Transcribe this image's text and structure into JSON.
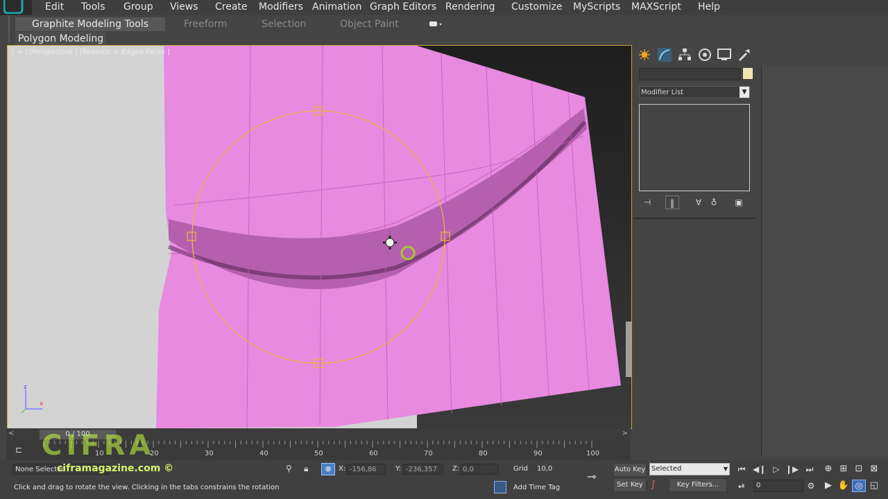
{
  "menu": {
    "items": [
      "Edit",
      "Tools",
      "Group",
      "Views",
      "Create",
      "Modifiers",
      "Animation",
      "Graph Editors",
      "Rendering",
      "Customize",
      "MyScripts",
      "MAXScript",
      "Help"
    ]
  },
  "ribbon": {
    "tabs": [
      "Graphite Modeling Tools",
      "Freeform",
      "Selection",
      "Object Paint"
    ],
    "subtab": "Polygon Modeling"
  },
  "viewport": {
    "label": "[ + ] [Perspective ] [Realistic + Edged Faces ]",
    "axis_z": "z",
    "axis_x": "x",
    "colors": {
      "cloth": "#e78ae0",
      "gizmo": "#f0b040",
      "frame": "#c8a53a"
    }
  },
  "command_panel": {
    "tab_icons": [
      "create-icon",
      "modify-icon",
      "hierarchy-icon",
      "motion-icon",
      "display-icon",
      "utilities-icon"
    ],
    "modifier_list_label": "Modifier List"
  },
  "timeline": {
    "slider_label": "0 / 100",
    "prev": "<",
    "next": ">",
    "ticks": [
      "10",
      "20",
      "30",
      "40",
      "50",
      "60",
      "70",
      "80",
      "90",
      "100"
    ]
  },
  "status": {
    "selection": "None Selected",
    "prompt": "Click and drag to rotate the view.  Clicking in the tabs constrains the rotation",
    "x_label": "X:",
    "x_value": "-156,86",
    "y_label": "Y:",
    "y_value": "-236,357",
    "z_label": "Z:",
    "z_value": "0,0",
    "grid_label": "Grid",
    "grid_value": "10,0",
    "add_time_tag": "Add Time Tag",
    "auto_key": "Auto Key",
    "set_key": "Set Key",
    "selected_option": "Selected",
    "key_filters": "Key Filters...",
    "frame_value": "0"
  },
  "watermark": {
    "big": "CIFRA",
    "small": "ciframagazine.com ©"
  }
}
